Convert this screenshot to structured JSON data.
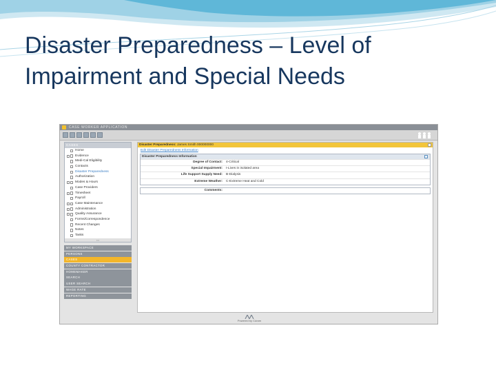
{
  "slide": {
    "title_line1": "Disaster Preparedness – Level of",
    "title_line2": "Impairment and Special Needs"
  },
  "app": {
    "name": "CASE WORKER APPLICATION",
    "accent_color": "#f2c53a",
    "tree_header": "CASES",
    "tree_items": [
      {
        "label": "Home",
        "expandable": false,
        "selected": false
      },
      {
        "label": "Evidence",
        "expandable": true,
        "selected": false
      },
      {
        "label": "Medi-Cal Eligibility",
        "expandable": false,
        "selected": false
      },
      {
        "label": "Contacts",
        "expandable": false,
        "selected": false
      },
      {
        "label": "Disaster Preparedness",
        "expandable": false,
        "selected": true
      },
      {
        "label": "Authorization",
        "expandable": false,
        "selected": false
      },
      {
        "label": "Modes & Hours",
        "expandable": true,
        "selected": false
      },
      {
        "label": "Case Providers",
        "expandable": false,
        "selected": false
      },
      {
        "label": "Timesheet",
        "expandable": true,
        "selected": false
      },
      {
        "label": "Payroll",
        "expandable": false,
        "selected": false
      },
      {
        "label": "Case Maintenance",
        "expandable": true,
        "selected": false
      },
      {
        "label": "Administration",
        "expandable": true,
        "selected": false
      },
      {
        "label": "Quality Assurance",
        "expandable": true,
        "selected": false
      },
      {
        "label": "Forms/Correspondence",
        "expandable": false,
        "selected": false
      },
      {
        "label": "Recent Changes",
        "expandable": false,
        "selected": false
      },
      {
        "label": "Notes",
        "expandable": false,
        "selected": false
      },
      {
        "label": "Tasks",
        "expandable": false,
        "selected": false
      }
    ],
    "nav_items": [
      {
        "label": "MY WORKSPACE",
        "active": false
      },
      {
        "label": "PERSONS",
        "active": false
      },
      {
        "label": "CASES",
        "active": true
      },
      {
        "label": "COUNTY CONTRACTOR",
        "active": false
      },
      {
        "label": "HOMEMAKER",
        "active": false
      },
      {
        "label": "SEARCH",
        "active": false
      },
      {
        "label": "USER SEARCH",
        "active": false
      },
      {
        "label": "WAGE RATE",
        "active": false
      },
      {
        "label": "REPORTING",
        "active": false
      }
    ],
    "main": {
      "title_label": "Disaster Preparedness:",
      "title_value": "James Smith 000000000",
      "edit_link": "Edit Disaster Preparedness Information",
      "panel_title": "Disaster Preparedness Information",
      "fields": [
        {
          "label": "Degree of Contact:",
          "value": "4-Critical"
        },
        {
          "label": "Special Impairment:",
          "value": "I-Lives in isolated area"
        },
        {
          "label": "Life Support Supply Need:",
          "value": "B-Dialysis"
        },
        {
          "label": "Extreme Weather:",
          "value": "C-Extreme Heat and Cold"
        }
      ],
      "comments_label": "Comments:"
    },
    "footer": "Powered by Cúram"
  }
}
